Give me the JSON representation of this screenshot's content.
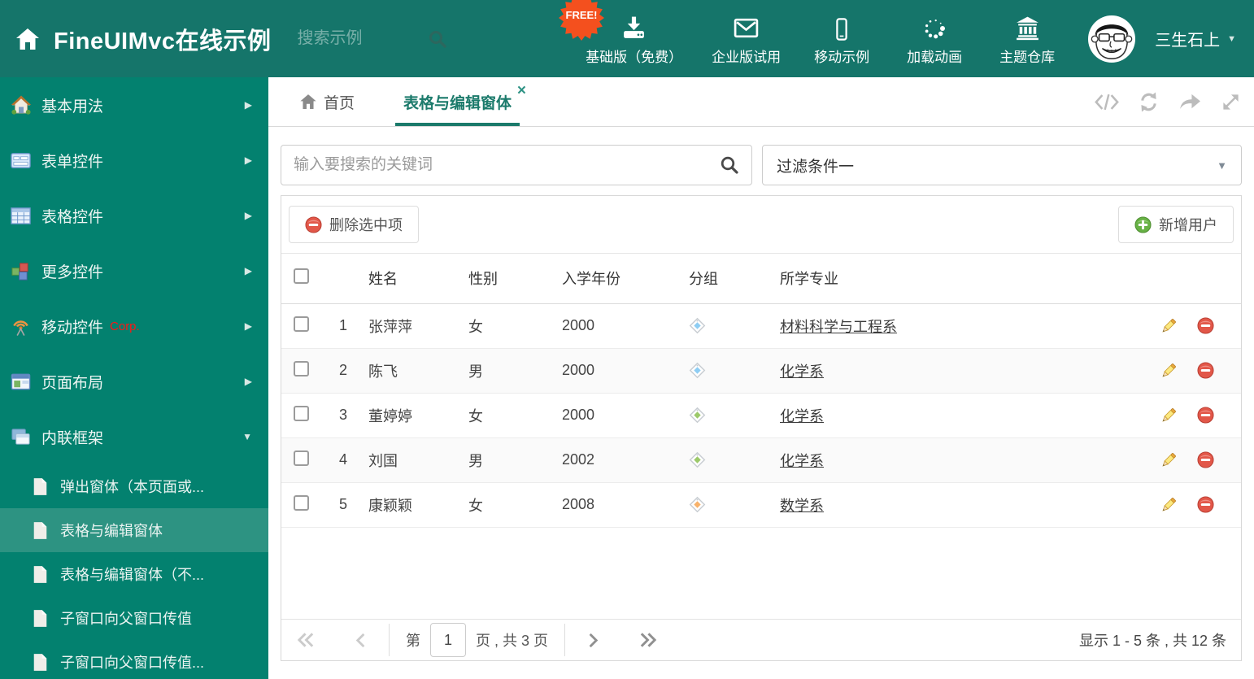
{
  "header": {
    "app_title": "FineUIMvc在线示例",
    "search_placeholder": "搜索示例",
    "free_badge": "FREE!",
    "nav_items": [
      {
        "id": "basic-edition",
        "label": "基础版（免费）",
        "icon": "download-icon"
      },
      {
        "id": "enterprise-trial",
        "label": "企业版试用",
        "icon": "envelope-icon"
      },
      {
        "id": "mobile-demo",
        "label": "移动示例",
        "icon": "mobile-icon"
      },
      {
        "id": "loading-animation",
        "label": "加载动画",
        "icon": "spinner-icon"
      },
      {
        "id": "theme-store",
        "label": "主题仓库",
        "icon": "bank-icon"
      }
    ],
    "username": "三生石上"
  },
  "sidebar": {
    "items": [
      {
        "id": "basic-usage",
        "label": "基本用法",
        "icon": "home-colorful-icon",
        "arrow": "right"
      },
      {
        "id": "form-controls",
        "label": "表单控件",
        "icon": "form-icon",
        "arrow": "right"
      },
      {
        "id": "grid-controls",
        "label": "表格控件",
        "icon": "table-icon",
        "arrow": "right"
      },
      {
        "id": "more-controls",
        "label": "更多控件",
        "icon": "cubes-icon",
        "arrow": "right"
      },
      {
        "id": "mobile-controls",
        "label": "移动控件",
        "badge": "Corp.",
        "icon": "antenna-icon",
        "arrow": "right"
      },
      {
        "id": "page-layout",
        "label": "页面布局",
        "icon": "layout-icon",
        "arrow": "right"
      },
      {
        "id": "inline-frame",
        "label": "内联框架",
        "icon": "frames-icon",
        "arrow": "down"
      }
    ],
    "subitems": [
      {
        "id": "popup-window",
        "label": "弹出窗体（本页面或...",
        "selected": false
      },
      {
        "id": "grid-edit-window",
        "label": "表格与编辑窗体",
        "selected": true
      },
      {
        "id": "grid-edit-window-no",
        "label": "表格与编辑窗体（不...",
        "selected": false
      },
      {
        "id": "child-to-parent",
        "label": "子窗口向父窗口传值",
        "selected": false
      },
      {
        "id": "child-to-parent-2",
        "label": "子窗口向父窗口传值...",
        "selected": false
      }
    ]
  },
  "tabs": [
    {
      "label": "首页",
      "active": false
    },
    {
      "label": "表格与编辑窗体",
      "active": true,
      "closable": true
    }
  ],
  "filters": {
    "search_placeholder": "输入要搜索的关键词",
    "filter_value": "过滤条件一"
  },
  "toolbar": {
    "delete_label": "删除选中项",
    "add_label": "新增用户"
  },
  "table": {
    "columns": [
      "姓名",
      "性别",
      "入学年份",
      "分组",
      "所学专业"
    ],
    "rows": [
      {
        "num": "1",
        "name": "张萍萍",
        "gender": "女",
        "year": "2000",
        "tag_color": "#8ecdf3",
        "major": "材料科学与工程系"
      },
      {
        "num": "2",
        "name": "陈飞",
        "gender": "男",
        "year": "2000",
        "tag_color": "#8ecdf3",
        "major": "化学系"
      },
      {
        "num": "3",
        "name": "董婷婷",
        "gender": "女",
        "year": "2000",
        "tag_color": "#9cc96a",
        "major": "化学系"
      },
      {
        "num": "4",
        "name": "刘国",
        "gender": "男",
        "year": "2002",
        "tag_color": "#9cc96a",
        "major": "化学系"
      },
      {
        "num": "5",
        "name": "康颖颖",
        "gender": "女",
        "year": "2008",
        "tag_color": "#f8b26a",
        "major": "数学系"
      }
    ]
  },
  "pagination": {
    "page_prefix": "第",
    "current_page": "1",
    "page_suffix": "页 , 共 3 页",
    "summary": "显示 1 - 5 条 , 共 12 条"
  }
}
